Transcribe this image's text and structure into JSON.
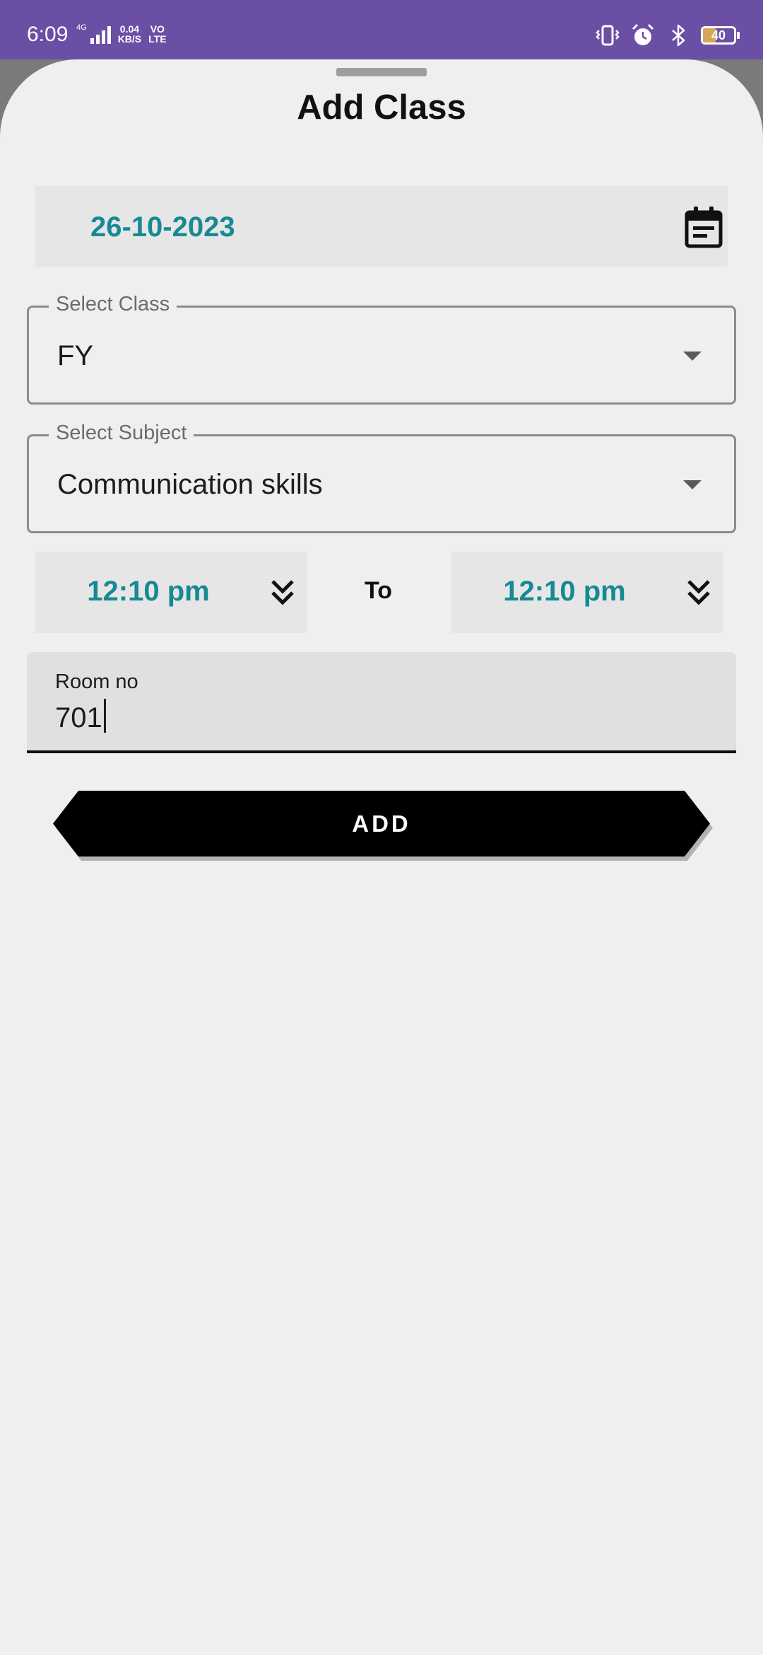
{
  "status_bar": {
    "time": "6:09",
    "network_type": "4G",
    "net_speed_value": "0.04",
    "net_speed_unit": "KB/S",
    "volte_top": "VO",
    "volte_bottom": "LTE",
    "battery_level": "40",
    "colors": {
      "background": "#6a4fa5"
    }
  },
  "sheet": {
    "title": "Add Class"
  },
  "form": {
    "date": "26-10-2023",
    "class_field": {
      "label": "Select Class",
      "value": "FY"
    },
    "subject_field": {
      "label": "Select Subject",
      "value": "Communication skills"
    },
    "time_from": "12:10 pm",
    "time_separator": "To",
    "time_to": "12:10 pm",
    "room_field": {
      "label": "Room no",
      "value": "701"
    },
    "add_button_label": "ADD"
  },
  "icons": {
    "calendar": "calendar-icon",
    "dropdown": "dropdown-arrow-icon",
    "time_picker": "double-chevron-down-icon"
  },
  "colors": {
    "accent_teal": "#168a93",
    "sheet_background": "#efefef",
    "button": "#000000"
  }
}
